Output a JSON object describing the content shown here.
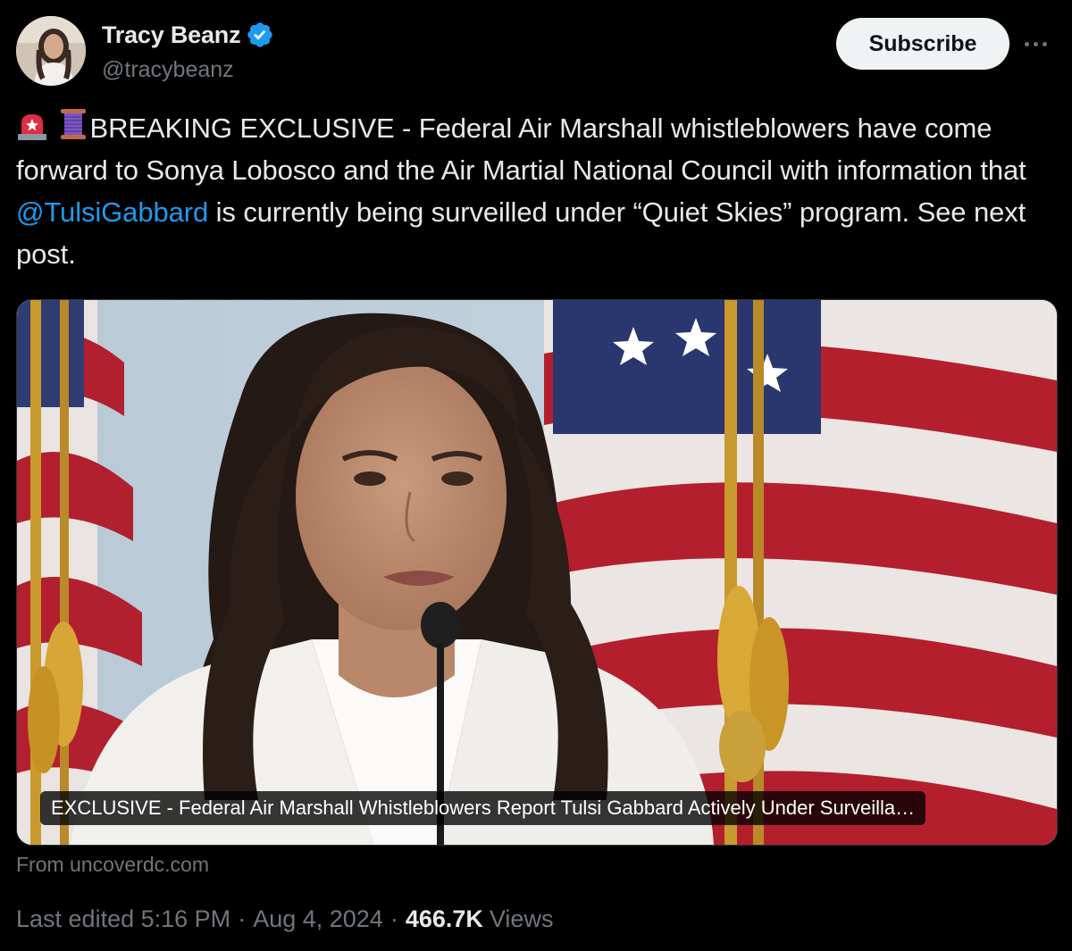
{
  "author": {
    "display_name": "Tracy Beanz",
    "handle": "@tracybeanz",
    "verified_icon": "verified-badge-icon",
    "avatar_icon": "avatar-photo"
  },
  "actions": {
    "subscribe_label": "Subscribe",
    "more_icon": "more-options-icon"
  },
  "tweet": {
    "emoji_1": "police-light-emoji",
    "emoji_2": "thread-spool-emoji",
    "text_before_mention": "BREAKING EXCLUSIVE - Federal Air Marshall whistleblowers have come forward to Sonya Lobosco and the Air Martial National Council with information that ",
    "mention": "@TulsiGabbard",
    "text_after_mention": " is currently being surveilled under “Quiet Skies” program. See next post."
  },
  "link_card": {
    "caption": "EXCLUSIVE - Federal Air Marshall Whistleblowers Report Tulsi Gabbard Actively Under Surveilla…",
    "source": "From uncoverdc.com"
  },
  "meta": {
    "edited_label": "Last edited",
    "time": "5:16 PM",
    "separator": "·",
    "date": "Aug 4, 2024",
    "views_count": "466.7K",
    "views_label": "Views"
  },
  "colors": {
    "background": "#000000",
    "text": "#e7e9ea",
    "muted": "#71767b",
    "link": "#1d9bf0",
    "verified": "#1d9bf0"
  }
}
